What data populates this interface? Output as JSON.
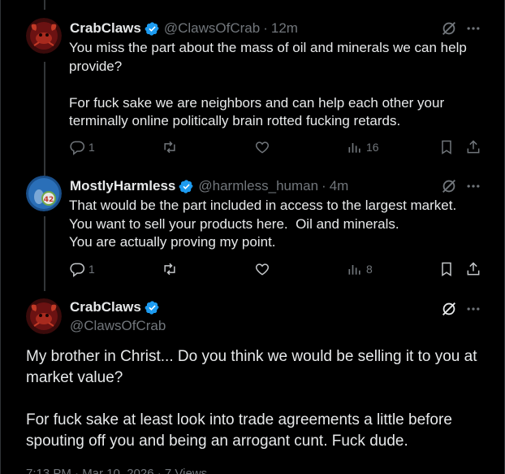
{
  "colors": {
    "background": "#000000",
    "text": "#e7e9ea",
    "muted": "#71767b",
    "verified": "#1d9bf0"
  },
  "reply1": {
    "name": "CrabClaws",
    "handle": "@ClawsOfCrab",
    "dot": "·",
    "time": "12m",
    "text": "You miss the part about the mass of oil and minerals we can help provide?\n\nFor fuck sake we are neighbors and can help each other your terminally online politically brain rotted fucking retards.",
    "replies": "1",
    "reposts": "",
    "likes": "",
    "views": "16"
  },
  "reply2": {
    "name": "MostlyHarmless",
    "handle": "@harmless_human",
    "dot": "·",
    "time": "4m",
    "text": "That would be the part included in access to the largest market.\nYou want to sell your products here.  Oil and minerals.\nYou are actually proving my point.",
    "replies": "1",
    "reposts": "",
    "likes": "",
    "views": "8",
    "avatar_badge": "42"
  },
  "main": {
    "name": "CrabClaws",
    "handle": "@ClawsOfCrab",
    "text": "My brother in Christ... Do you think we would be selling it to you at market value?\n\nFor fuck sake at least look into trade agreements a little before spouting off you and being an arrogant cunt. Fuck dude.",
    "footer": "7:13 PM · Mar 10, 2026 · 7 Views"
  },
  "icons": [
    "verified-icon",
    "grok-icon",
    "more-icon",
    "reply-icon",
    "repost-icon",
    "like-icon",
    "views-icon",
    "bookmark-icon",
    "share-icon"
  ]
}
